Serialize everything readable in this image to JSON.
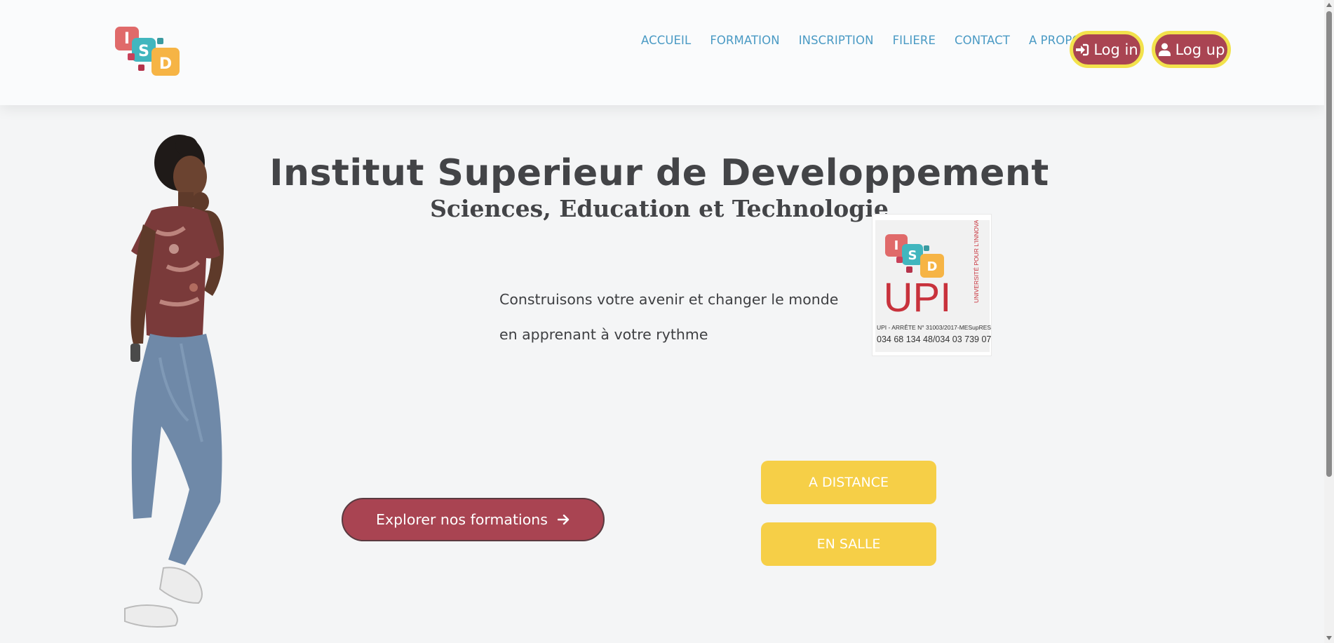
{
  "header": {
    "logo_letters": [
      "I",
      "S",
      "D"
    ],
    "nav": [
      "ACCUEIL",
      "FORMATION",
      "INSCRIPTION",
      "FILIERE",
      "CONTACT",
      "A PROPOS"
    ],
    "login_label": "Log in",
    "logup_label": "Log up"
  },
  "hero": {
    "title": "Institut Superieur de Developpement",
    "subtitle": "Sciences, Education et Technologie",
    "tagline_line1": "Construisons votre avenir et changer le monde",
    "tagline_line2": "en apprenant à votre rythme",
    "explore_label": "Explorer nos formations",
    "mode_distance": "A DISTANCE",
    "mode_salle": "EN SALLE"
  },
  "upi_badge": {
    "letters": [
      "I",
      "S",
      "D"
    ],
    "upi_text": "UPI",
    "side_text": "UNIVERSITÉ POUR L'INNOVATION",
    "arrete": "UPI - ARRÊTE N° 31003/2017-MESupRES",
    "phones": "034 68 134 48/034 03 739 07"
  },
  "colors": {
    "brand_red": "#a94452",
    "brand_yellow": "#f6cf47",
    "nav_blue": "#4a9ac4",
    "logo_red": "#e06a6a",
    "logo_teal": "#41b6be",
    "logo_orange": "#f6b445"
  },
  "icons": {
    "login": "sign-in-icon",
    "logup": "user-icon",
    "explore": "arrow-right-icon"
  }
}
